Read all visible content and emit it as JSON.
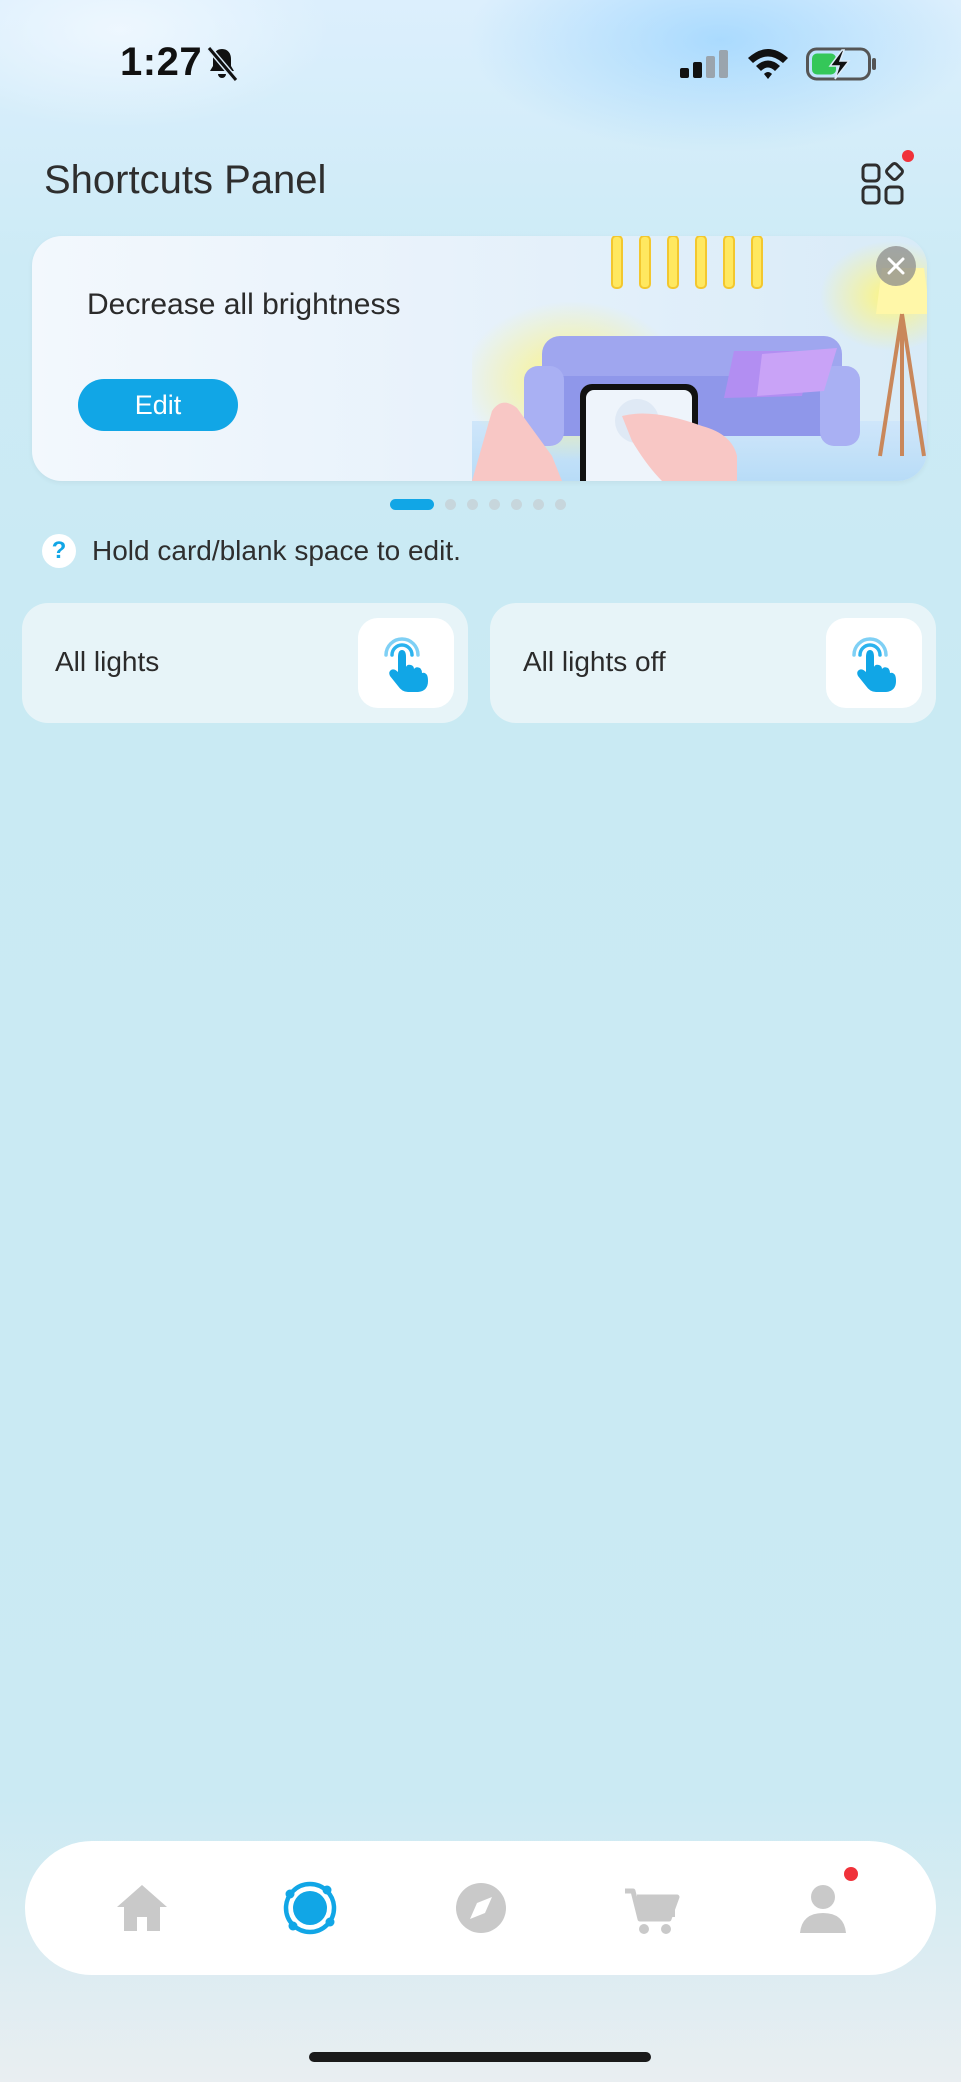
{
  "status_bar": {
    "time": "1:27",
    "icons": [
      "bell-off-icon",
      "cellular-signal-icon",
      "wifi-icon",
      "battery-charging-icon"
    ]
  },
  "header": {
    "title": "Shortcuts Panel",
    "widgets_icon": "grid-widgets-icon",
    "has_notification_dot": true
  },
  "banner": {
    "title": "Decrease all brightness",
    "edit_label": "Edit",
    "close_icon": "close-icon",
    "page_count": 7,
    "active_page": 1
  },
  "hint": {
    "icon_text": "?",
    "text": "Hold card/blank space to edit."
  },
  "shortcuts": [
    {
      "label": "All lights",
      "icon": "tap-hand-icon"
    },
    {
      "label": "All lights off",
      "icon": "tap-hand-icon"
    }
  ],
  "bottom_nav": {
    "items": [
      {
        "name": "home",
        "icon": "home-icon",
        "active": false
      },
      {
        "name": "shortcuts",
        "icon": "scene-ring-icon",
        "active": true
      },
      {
        "name": "discover",
        "icon": "compass-icon",
        "active": false
      },
      {
        "name": "shop",
        "icon": "cart-icon",
        "active": false
      },
      {
        "name": "profile",
        "icon": "person-icon",
        "active": false,
        "badge": true
      }
    ]
  },
  "colors": {
    "accent": "#11a6e6",
    "badge": "#f0323a",
    "inactive_icon": "#c9c9c9"
  }
}
